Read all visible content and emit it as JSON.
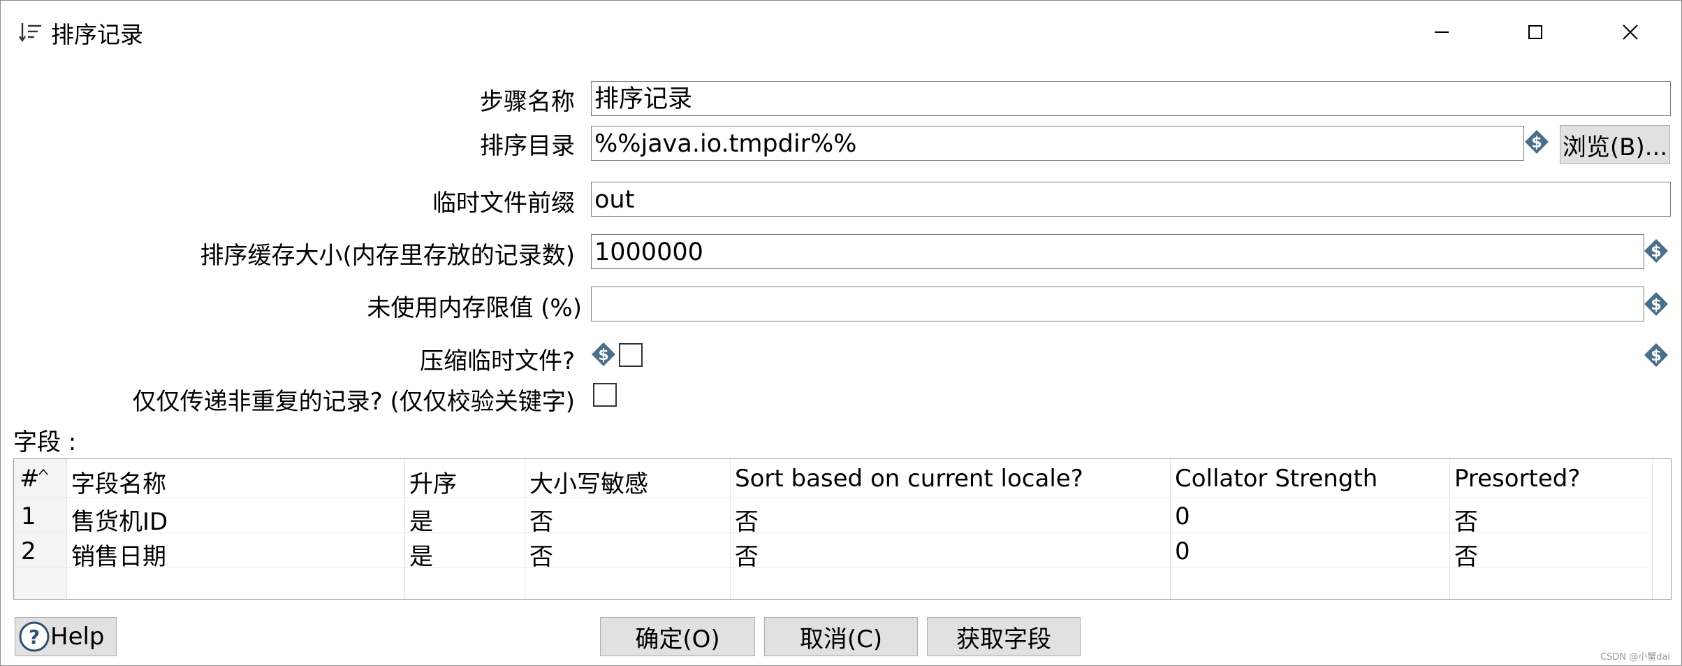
{
  "window": {
    "title": "排序记录"
  },
  "form": {
    "step_name": {
      "label": "步骤名称",
      "value": "排序记录"
    },
    "sort_dir": {
      "label": "排序目录",
      "value": "%%java.io.tmpdir%%",
      "browse_label": "浏览(B)..."
    },
    "temp_prefix": {
      "label": "临时文件前缀",
      "value": "out"
    },
    "sort_size": {
      "label": "排序缓存大小(内存里存放的记录数)",
      "value": "1000000"
    },
    "free_memory": {
      "label": "未使用内存限值 (%)",
      "value": ""
    },
    "compress": {
      "label": "压缩临时文件?",
      "checked": false
    },
    "unique_rows": {
      "label": "仅仅传递非重复的记录? (仅仅校验关键字)",
      "checked": false
    }
  },
  "fields": {
    "label": "字段 :",
    "columns": [
      "#",
      "字段名称",
      "升序",
      "大小写敏感",
      "Sort based on current locale?",
      "Collator Strength",
      "Presorted?"
    ],
    "rows": [
      [
        "1",
        "售货机ID",
        "是",
        "否",
        "否",
        "0",
        "否"
      ],
      [
        "2",
        "销售日期",
        "是",
        "否",
        "否",
        "0",
        "否"
      ]
    ]
  },
  "buttons": {
    "help": "Help",
    "ok": "确定(O)",
    "cancel": "取消(C)",
    "get_fields": "获取字段"
  },
  "watermark": "CSDN @小蟹dai",
  "icons": {
    "title": "sort-icon",
    "variable": "dollar-diamond-icon",
    "help": "question-circle-icon"
  },
  "colors": {
    "variable_icon": "#4a6f8a",
    "button_bg": "#e1e1e1"
  }
}
